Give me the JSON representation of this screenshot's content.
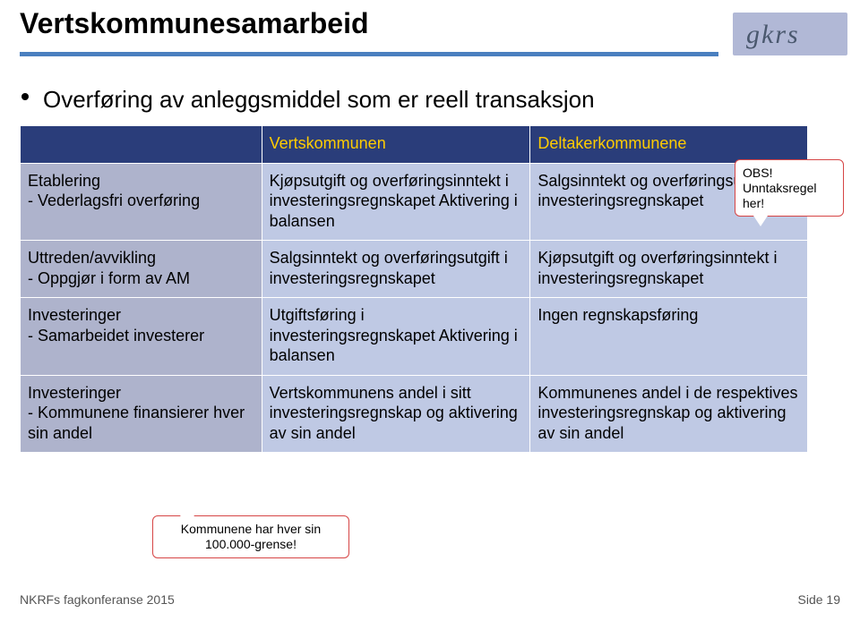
{
  "logo_text": "gkrs",
  "title": "Vertskommunesamarbeid",
  "bullet": "Overføring av anleggsmiddel som er reell transaksjon",
  "table": {
    "header": {
      "col1": "Vertskommunen",
      "col2": "Deltakerkommunene"
    },
    "rows": [
      {
        "label_main": "Etablering",
        "label_sub": "- Vederlagsfri overføring",
        "col1": "Kjøpsutgift og overføringsinntekt i investeringsregnskapet Aktivering i balansen",
        "col2": "Salgsinntekt og overføringsutgift i investeringsregnskapet"
      },
      {
        "label_main": "Uttreden/avvikling",
        "label_sub": "- Oppgjør i form av AM",
        "col1": "Salgsinntekt og overføringsutgift i investeringsregnskapet",
        "col2": "Kjøpsutgift og overføringsinntekt i investeringsregnskapet"
      },
      {
        "label_main": "Investeringer",
        "label_sub": "- Samarbeidet investerer",
        "col1": "Utgiftsføring i investeringsregnskapet Aktivering i balansen",
        "col2": "Ingen regnskapsføring"
      },
      {
        "label_main": "Investeringer",
        "label_sub": "- Kommunene finansierer hver sin andel",
        "col1": "Vertskommunens andel i sitt investeringsregnskap og aktivering av sin andel",
        "col2": "Kommunenes andel i de respektives investeringsregnskap og aktivering av sin andel"
      }
    ]
  },
  "callouts": {
    "obs_line1": "OBS!",
    "obs_line2": "Unntaksregel her!",
    "grense": "Kommunene har hver sin 100.000-grense!"
  },
  "footer": {
    "left": "NKRFs fagkonferanse 2015",
    "right": "Side 19"
  }
}
